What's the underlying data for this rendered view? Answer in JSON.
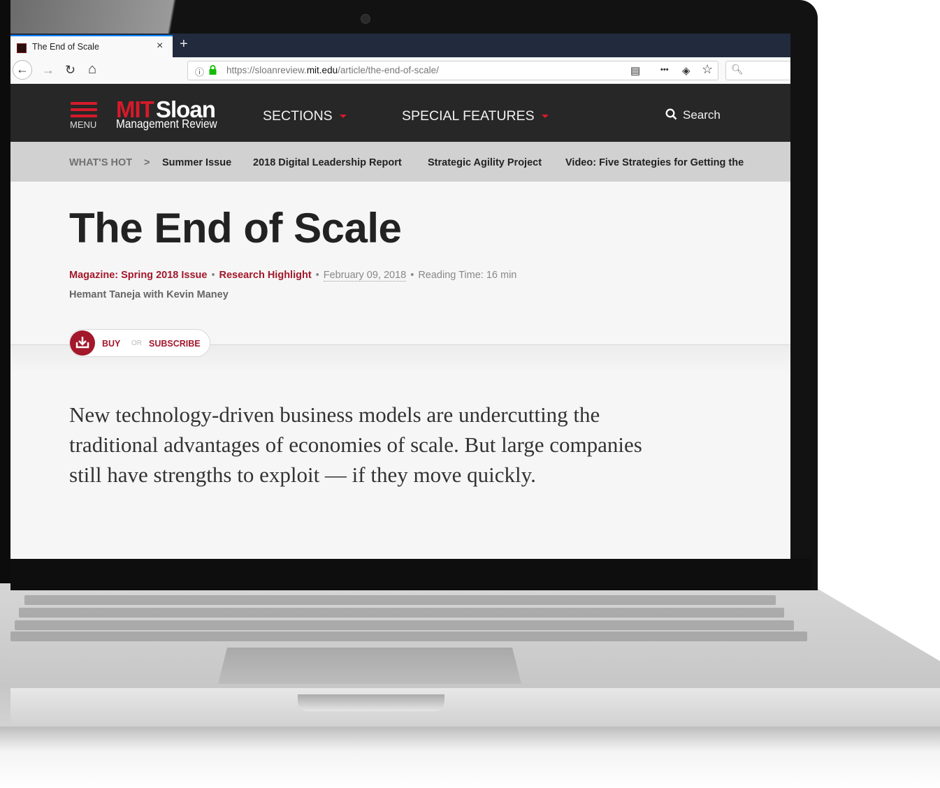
{
  "browser": {
    "tab_title": "The End of Scale",
    "tab_close": "×",
    "new_tab": "+",
    "back": "←",
    "forward": "→",
    "reload": "↻",
    "home": "⌂",
    "url_prefix": "https://sloanreview.",
    "url_domain": "mit.edu",
    "url_path": "/article/the-end-of-scale/",
    "reader_icon": "▤",
    "more_icon": "•••",
    "pocket_icon": "◈",
    "bookmark_icon": "☆",
    "search_icon": "🔍︎"
  },
  "site": {
    "menu_label": "MENU",
    "logo_mit": "MIT",
    "logo_sloan": "Sloan",
    "logo_sub": "Management Review",
    "nav": [
      "SECTIONS",
      "SPECIAL FEATURES"
    ],
    "search_label": "Search"
  },
  "whats_hot": {
    "label": "WHAT'S HOT",
    "arrow": ">",
    "items": [
      "Summer Issue",
      "2018 Digital Leadership Report",
      "Strategic Agility Project",
      "Video: Five Strategies for Getting the"
    ]
  },
  "article": {
    "title": "The End of Scale",
    "issue": "Magazine: Spring 2018 Issue",
    "type": "Research Highlight",
    "date": "February 09, 2018",
    "reading_time": "Reading Time: 16 min",
    "authors": "Hemant Taneja with Kevin Maney",
    "buy_label": "BUY",
    "or_label": "OR",
    "subscribe_label": "SUBSCRIBE",
    "dek": "New technology-driven business models are undercutting the traditional advantages of economies of scale. But large companies still have strengths to exploit — if they move quickly."
  },
  "colors": {
    "brand_red": "#d61a2a",
    "link_red": "#a3182b",
    "header_bg": "#272727",
    "tabbar_bg": "#212b3d"
  }
}
